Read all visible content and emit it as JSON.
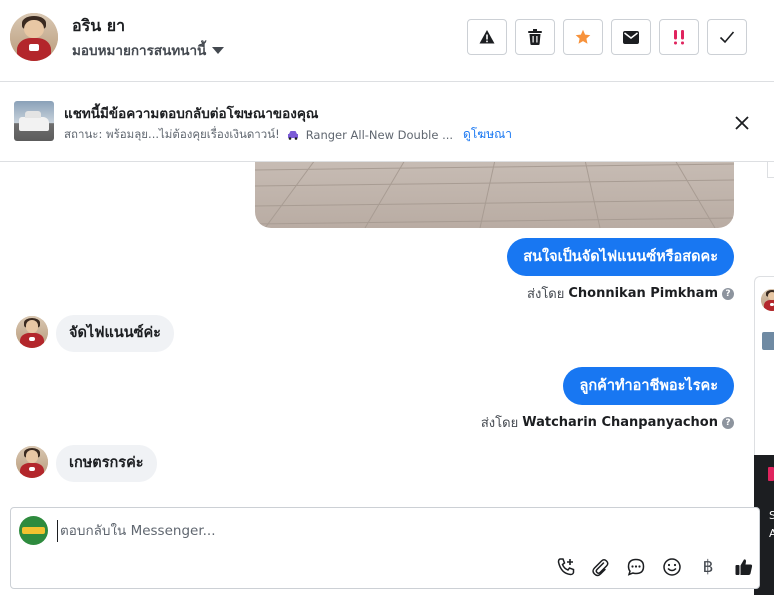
{
  "header": {
    "contact_name": "อริน ยา",
    "assign_label": "มอบหมายการสนทนานี้",
    "tools": [
      {
        "name": "report-button",
        "icon": "warning-icon"
      },
      {
        "name": "delete-button",
        "icon": "trash-icon"
      },
      {
        "name": "star-button",
        "icon": "star-icon",
        "color": "#f7923b"
      },
      {
        "name": "mark-unread-button",
        "icon": "envelope-icon"
      },
      {
        "name": "important-button",
        "icon": "double-exclamation-icon",
        "color": "#e0245e"
      },
      {
        "name": "mark-done-button",
        "icon": "check-icon"
      }
    ]
  },
  "ad_banner": {
    "title": "แชทนี้มีข้อความตอบกลับต่อโฆษณาของคุณ",
    "status": "สถานะ: พร้อมลุย...ไม่ต้องคุยเรื่องเงินดาวน์!",
    "ad_name": "Ranger All-New Double ...",
    "view_ad": "ดูโฆษณา"
  },
  "messages": [
    {
      "dir": "out",
      "text": "สนใจเป็นจัดไฟแนนซ์หรือสดคะ",
      "sent_by_prefix": "ส่งโดย",
      "sent_by": "Chonnikan Pimkham"
    },
    {
      "dir": "in",
      "text": "จัดไฟแนนซ์ค่ะ"
    },
    {
      "dir": "out",
      "text": "ลูกค้าทำอาชีพอะไรคะ",
      "sent_by_prefix": "ส่งโดย",
      "sent_by": "Watcharin Chanpanyachon"
    },
    {
      "dir": "in",
      "text": "เกษตรกรค่ะ"
    }
  ],
  "composer": {
    "placeholder": "ตอบกลับใน Messenger...",
    "icons": [
      "add-call-icon",
      "attachment-icon",
      "saved-reply-icon",
      "emoji-icon",
      "baht-icon",
      "thumbs-up-icon"
    ],
    "baht_symbol": "฿"
  },
  "side_panel": {
    "text_1": "S",
    "text_2": "A"
  },
  "colors": {
    "accent": "#1877f2",
    "incoming_bubble": "#f0f2f5",
    "star": "#f7923b",
    "important": "#e0245e"
  }
}
